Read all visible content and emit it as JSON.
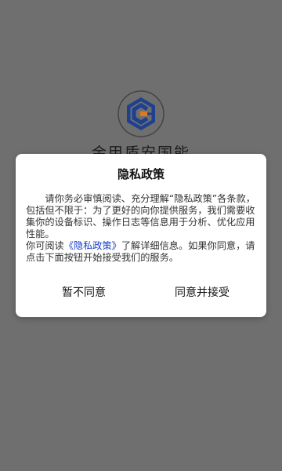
{
  "splash": {
    "logo_icon": "shield-c-logo-icon",
    "app_name": "金甲盾安国能"
  },
  "dialog": {
    "title": "隐私政策",
    "para1": "请你务必审慎阅读、充分理解“隐私政策”各条款，包括但不限于：为了更好的向你提供服务，我们需要收集你的设备标识、操作日志等信息用于分析、优化应用性能。",
    "para2_prefix": "你可阅读",
    "para2_link": "《隐私政策》",
    "para2_suffix": "了解详细信息。如果你同意，请点击下面按钮开始接受我们的服务。",
    "disagree_label": "暂不同意",
    "agree_label": "同意并接受"
  },
  "colors": {
    "overlay": "#6f6f6f",
    "link": "#1a3ec8",
    "logo_blue": "#1f3f8f"
  }
}
